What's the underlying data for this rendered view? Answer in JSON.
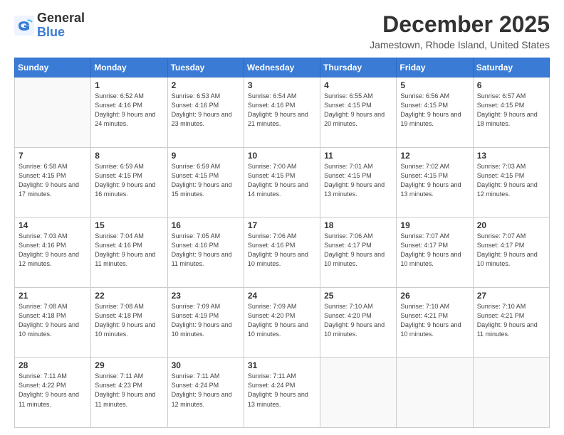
{
  "logo": {
    "general": "General",
    "blue": "Blue"
  },
  "title": "December 2025",
  "location": "Jamestown, Rhode Island, United States",
  "days_of_week": [
    "Sunday",
    "Monday",
    "Tuesday",
    "Wednesday",
    "Thursday",
    "Friday",
    "Saturday"
  ],
  "weeks": [
    [
      {
        "day": null,
        "info": null
      },
      {
        "day": "1",
        "sunrise": "6:52 AM",
        "sunset": "4:16 PM",
        "daylight": "9 hours and 24 minutes."
      },
      {
        "day": "2",
        "sunrise": "6:53 AM",
        "sunset": "4:16 PM",
        "daylight": "9 hours and 23 minutes."
      },
      {
        "day": "3",
        "sunrise": "6:54 AM",
        "sunset": "4:16 PM",
        "daylight": "9 hours and 21 minutes."
      },
      {
        "day": "4",
        "sunrise": "6:55 AM",
        "sunset": "4:15 PM",
        "daylight": "9 hours and 20 minutes."
      },
      {
        "day": "5",
        "sunrise": "6:56 AM",
        "sunset": "4:15 PM",
        "daylight": "9 hours and 19 minutes."
      },
      {
        "day": "6",
        "sunrise": "6:57 AM",
        "sunset": "4:15 PM",
        "daylight": "9 hours and 18 minutes."
      }
    ],
    [
      {
        "day": "7",
        "sunrise": "6:58 AM",
        "sunset": "4:15 PM",
        "daylight": "9 hours and 17 minutes."
      },
      {
        "day": "8",
        "sunrise": "6:59 AM",
        "sunset": "4:15 PM",
        "daylight": "9 hours and 16 minutes."
      },
      {
        "day": "9",
        "sunrise": "6:59 AM",
        "sunset": "4:15 PM",
        "daylight": "9 hours and 15 minutes."
      },
      {
        "day": "10",
        "sunrise": "7:00 AM",
        "sunset": "4:15 PM",
        "daylight": "9 hours and 14 minutes."
      },
      {
        "day": "11",
        "sunrise": "7:01 AM",
        "sunset": "4:15 PM",
        "daylight": "9 hours and 13 minutes."
      },
      {
        "day": "12",
        "sunrise": "7:02 AM",
        "sunset": "4:15 PM",
        "daylight": "9 hours and 13 minutes."
      },
      {
        "day": "13",
        "sunrise": "7:03 AM",
        "sunset": "4:15 PM",
        "daylight": "9 hours and 12 minutes."
      }
    ],
    [
      {
        "day": "14",
        "sunrise": "7:03 AM",
        "sunset": "4:16 PM",
        "daylight": "9 hours and 12 minutes."
      },
      {
        "day": "15",
        "sunrise": "7:04 AM",
        "sunset": "4:16 PM",
        "daylight": "9 hours and 11 minutes."
      },
      {
        "day": "16",
        "sunrise": "7:05 AM",
        "sunset": "4:16 PM",
        "daylight": "9 hours and 11 minutes."
      },
      {
        "day": "17",
        "sunrise": "7:06 AM",
        "sunset": "4:16 PM",
        "daylight": "9 hours and 10 minutes."
      },
      {
        "day": "18",
        "sunrise": "7:06 AM",
        "sunset": "4:17 PM",
        "daylight": "9 hours and 10 minutes."
      },
      {
        "day": "19",
        "sunrise": "7:07 AM",
        "sunset": "4:17 PM",
        "daylight": "9 hours and 10 minutes."
      },
      {
        "day": "20",
        "sunrise": "7:07 AM",
        "sunset": "4:17 PM",
        "daylight": "9 hours and 10 minutes."
      }
    ],
    [
      {
        "day": "21",
        "sunrise": "7:08 AM",
        "sunset": "4:18 PM",
        "daylight": "9 hours and 10 minutes."
      },
      {
        "day": "22",
        "sunrise": "7:08 AM",
        "sunset": "4:18 PM",
        "daylight": "9 hours and 10 minutes."
      },
      {
        "day": "23",
        "sunrise": "7:09 AM",
        "sunset": "4:19 PM",
        "daylight": "9 hours and 10 minutes."
      },
      {
        "day": "24",
        "sunrise": "7:09 AM",
        "sunset": "4:20 PM",
        "daylight": "9 hours and 10 minutes."
      },
      {
        "day": "25",
        "sunrise": "7:10 AM",
        "sunset": "4:20 PM",
        "daylight": "9 hours and 10 minutes."
      },
      {
        "day": "26",
        "sunrise": "7:10 AM",
        "sunset": "4:21 PM",
        "daylight": "9 hours and 10 minutes."
      },
      {
        "day": "27",
        "sunrise": "7:10 AM",
        "sunset": "4:21 PM",
        "daylight": "9 hours and 11 minutes."
      }
    ],
    [
      {
        "day": "28",
        "sunrise": "7:11 AM",
        "sunset": "4:22 PM",
        "daylight": "9 hours and 11 minutes."
      },
      {
        "day": "29",
        "sunrise": "7:11 AM",
        "sunset": "4:23 PM",
        "daylight": "9 hours and 11 minutes."
      },
      {
        "day": "30",
        "sunrise": "7:11 AM",
        "sunset": "4:24 PM",
        "daylight": "9 hours and 12 minutes."
      },
      {
        "day": "31",
        "sunrise": "7:11 AM",
        "sunset": "4:24 PM",
        "daylight": "9 hours and 13 minutes."
      },
      {
        "day": null,
        "info": null
      },
      {
        "day": null,
        "info": null
      },
      {
        "day": null,
        "info": null
      }
    ]
  ],
  "labels": {
    "sunrise": "Sunrise:",
    "sunset": "Sunset:",
    "daylight": "Daylight:"
  }
}
